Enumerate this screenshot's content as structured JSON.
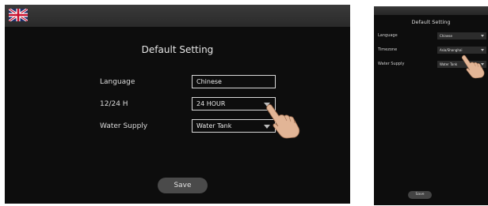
{
  "left_screen": {
    "title": "Default Setting",
    "language_label": "Language",
    "language_value": "Chinese",
    "time_format_label": "12/24 H",
    "time_format_value": "24 HOUR",
    "water_supply_label": "Water Supply",
    "water_supply_value": "Water Tank",
    "save_label": "Save"
  },
  "right_screen": {
    "title": "Default Setting",
    "language_label": "Language",
    "language_value": "Chinese",
    "timezone_label": "Timezone",
    "timezone_value": "Asia/Shanghai",
    "water_supply_label": "Water Supply",
    "water_supply_value": "Water Tank",
    "save_label": "Save"
  },
  "icons": {
    "flag": "uk-flag-icon",
    "dropdown": "chevron-down-icon",
    "pointer": "pointing-hand-icon"
  },
  "colors": {
    "screen_background": "#0d0d0d",
    "save_button": "#4a4a4a",
    "text": "#e6e6e6"
  }
}
